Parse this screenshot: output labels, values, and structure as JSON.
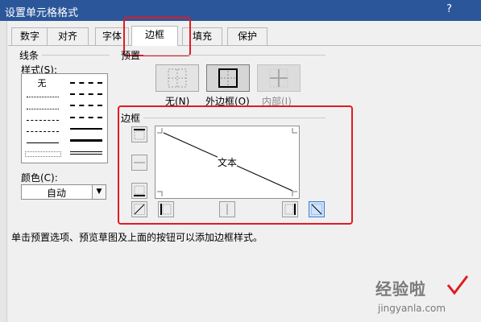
{
  "window": {
    "title": "设置单元格格式",
    "help": "?"
  },
  "tabs": [
    {
      "label": "数字"
    },
    {
      "label": "对齐"
    },
    {
      "label": "字体"
    },
    {
      "label": "边框"
    },
    {
      "label": "填充"
    },
    {
      "label": "保护"
    }
  ],
  "active_tab": "边框",
  "line": {
    "section_label": "线条",
    "style_label": "样式(S):",
    "style_none": "无",
    "color_label": "颜色(C):",
    "color_value": "自动"
  },
  "presets": {
    "section_label": "预置",
    "items": [
      {
        "label": "无(N)"
      },
      {
        "label": "外边框(O)"
      },
      {
        "label": "内部(I)"
      }
    ]
  },
  "border": {
    "section_label": "边框",
    "preview_text": "文本"
  },
  "hint": "单击预置选项、预览草图及上面的按钮可以添加边框样式。",
  "watermark": {
    "text": "经验啦",
    "url": "jingyanla.com"
  },
  "colors": {
    "highlight": "#e01b24",
    "titlebar": "#2b579a",
    "check": "#e01b24"
  }
}
